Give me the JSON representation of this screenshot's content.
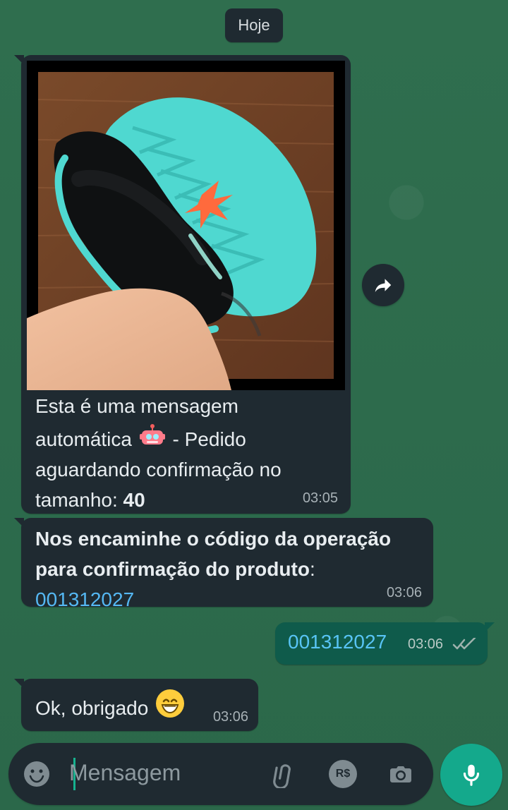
{
  "chat": {
    "date_separator": "Hoje",
    "messages": [
      {
        "id": "m1",
        "side": "incoming",
        "image_alt": "Sandália",
        "text_prefix": "Esta é uma mensagem automática",
        "text_suffix": " - Pedido aguardando confirmação no tamanho: ",
        "text_bold": "40",
        "time": "03:05"
      },
      {
        "id": "m2",
        "side": "incoming",
        "text_bold": "Nos encaminhe o código da operação para confirmação do produto",
        "text_after_bold": ":",
        "code": "001312027",
        "time": "03:06"
      },
      {
        "id": "m3",
        "side": "outgoing",
        "text": "001312027",
        "time": "03:06",
        "status": "double-check-icon"
      },
      {
        "id": "m4",
        "side": "incoming",
        "text": "Ok, obrigado",
        "time": "03:06"
      }
    ]
  },
  "composer": {
    "placeholder": "Mensagem",
    "icons": {
      "emoji": "emoji-icon",
      "attach": "paperclip-icon",
      "payment": "brl-payment-icon",
      "camera": "camera-icon",
      "mic": "mic-icon"
    },
    "payment_label": "R$"
  },
  "actions": {
    "forward": "forward-icon"
  },
  "colors": {
    "background": "#2c6b4c",
    "incoming_bubble": "#1f2a31",
    "outgoing_bubble": "#0f5b4b",
    "link": "#55b8f3",
    "accent": "#14a98c",
    "time_text": "#a7b1b6"
  }
}
